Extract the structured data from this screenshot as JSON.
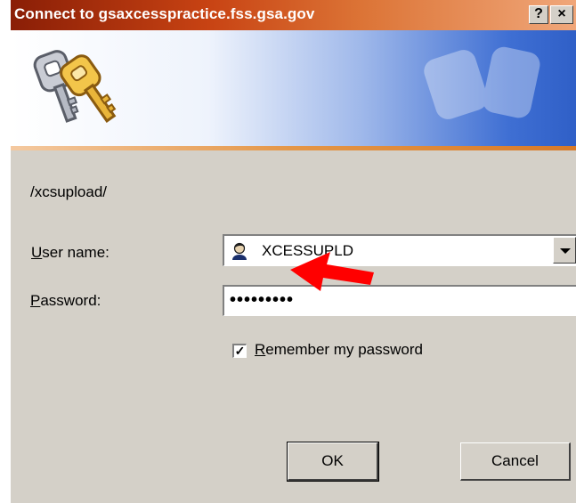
{
  "window": {
    "title": "Connect to gsaxcesspractice.fss.gsa.gov",
    "help_label": "?",
    "close_label": "×"
  },
  "form": {
    "realm_path": "/xcsupload/",
    "user_label_mnemonic": "U",
    "user_label_rest": "ser name:",
    "user_value": "XCESSUPLD",
    "password_label_mnemonic": "P",
    "password_label_rest": "assword:",
    "password_mask": "•••••••••",
    "remember_mnemonic": "R",
    "remember_rest": "emember my password",
    "remember_checked": "✓"
  },
  "buttons": {
    "ok": "OK",
    "cancel": "Cancel"
  },
  "colors": {
    "annotation_arrow": "#ff0000",
    "dialog_face": "#d4d0c8"
  },
  "icons": [
    "keys-icon",
    "user-icon",
    "dropdown-arrow-icon",
    "help-icon",
    "close-icon",
    "red-annotation-arrow"
  ]
}
